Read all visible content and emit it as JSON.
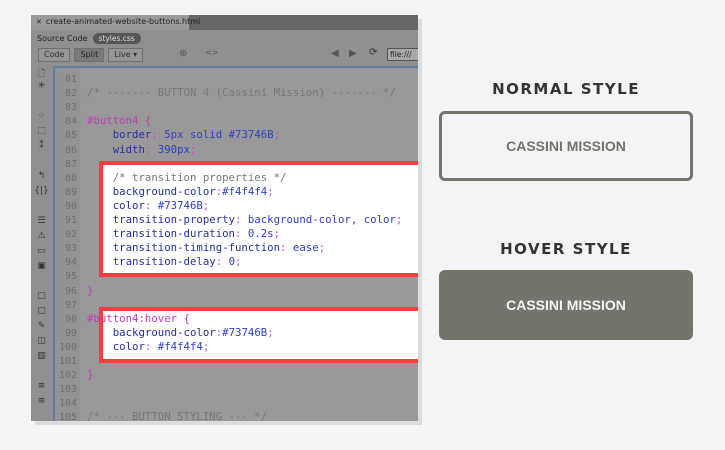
{
  "window": {
    "tab_title": "create-animated-website-buttons.html",
    "source_label": "Source Code",
    "file_pill": "styles.css",
    "url": "file:///"
  },
  "toolbar": {
    "code": "Code",
    "split": "Split",
    "live": "Live"
  },
  "code_lines": [
    {
      "n": "81",
      "t": []
    },
    {
      "n": "82",
      "t": [
        [
          "c",
          "/* ------- BUTTON 4 (Cassini Mission) ------- */"
        ]
      ]
    },
    {
      "n": "83",
      "t": []
    },
    {
      "n": "84",
      "t": [
        [
          "s",
          "#button4 {"
        ]
      ]
    },
    {
      "n": "85",
      "t": [
        [
          "p",
          "    border"
        ],
        [
          "u",
          ": "
        ],
        [
          "v",
          "5px solid #73746B"
        ],
        [
          "u",
          ";"
        ]
      ]
    },
    {
      "n": "86",
      "t": [
        [
          "p",
          "    width"
        ],
        [
          "u",
          ": "
        ],
        [
          "v",
          "390px"
        ],
        [
          "u",
          ";"
        ]
      ]
    },
    {
      "n": "87",
      "t": []
    },
    {
      "n": "88",
      "t": [
        [
          "c",
          "    /* transition properties */"
        ]
      ]
    },
    {
      "n": "89",
      "t": [
        [
          "p",
          "    background-color"
        ],
        [
          "u",
          ":"
        ],
        [
          "v",
          "#f4f4f4"
        ],
        [
          "u",
          ";"
        ]
      ]
    },
    {
      "n": "90",
      "t": [
        [
          "p",
          "    color"
        ],
        [
          "u",
          ": "
        ],
        [
          "v",
          "#73746B"
        ],
        [
          "u",
          ";"
        ]
      ]
    },
    {
      "n": "91",
      "t": [
        [
          "p",
          "    transition-property"
        ],
        [
          "u",
          ": "
        ],
        [
          "v",
          "background-color, color"
        ],
        [
          "u",
          ";"
        ]
      ]
    },
    {
      "n": "92",
      "t": [
        [
          "p",
          "    transition-duration"
        ],
        [
          "u",
          ": "
        ],
        [
          "v",
          "0.2s"
        ],
        [
          "u",
          ";"
        ]
      ]
    },
    {
      "n": "93",
      "t": [
        [
          "p",
          "    transition-timing-function"
        ],
        [
          "u",
          ": "
        ],
        [
          "v",
          "ease"
        ],
        [
          "u",
          ";"
        ]
      ]
    },
    {
      "n": "94",
      "t": [
        [
          "p",
          "    transition-delay"
        ],
        [
          "u",
          ": "
        ],
        [
          "v",
          "0"
        ],
        [
          "u",
          ";"
        ]
      ]
    },
    {
      "n": "95",
      "t": []
    },
    {
      "n": "96",
      "t": [
        [
          "s",
          "}"
        ]
      ]
    },
    {
      "n": "97",
      "t": []
    },
    {
      "n": "98",
      "t": [
        [
          "s",
          "#button4:hover {"
        ]
      ]
    },
    {
      "n": "99",
      "t": [
        [
          "p",
          "    background-color"
        ],
        [
          "u",
          ":"
        ],
        [
          "v",
          "#73746B"
        ],
        [
          "u",
          ";"
        ]
      ]
    },
    {
      "n": "100",
      "t": [
        [
          "p",
          "    color"
        ],
        [
          "u",
          ": "
        ],
        [
          "v",
          "#f4f4f4"
        ],
        [
          "u",
          ";"
        ]
      ]
    },
    {
      "n": "101",
      "t": []
    },
    {
      "n": "102",
      "t": [
        [
          "s",
          "}"
        ]
      ]
    },
    {
      "n": "103",
      "t": []
    },
    {
      "n": "104",
      "t": []
    },
    {
      "n": "105",
      "t": [
        [
          "c",
          "/* --- BUTTON STYLING --- */"
        ]
      ]
    }
  ],
  "preview": {
    "normal_heading": "NORMAL STYLE",
    "normal_button": "CASSINI MISSION",
    "hover_heading": "HOVER STYLE",
    "hover_button": "CASSINI MISSION"
  },
  "colors": {
    "button": "#73746B",
    "bg": "#f4f4f4",
    "highlight": "#f04040"
  }
}
